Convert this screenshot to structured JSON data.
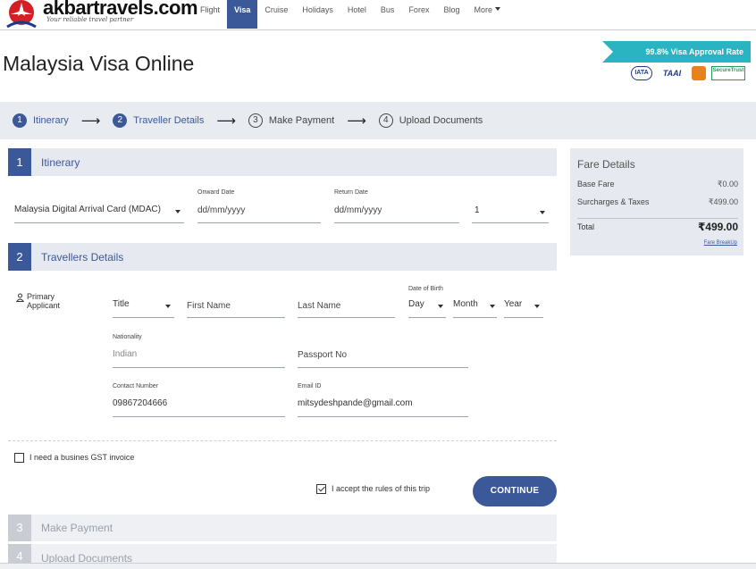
{
  "header": {
    "logo_text": "akbartravels",
    "logo_suffix": ".com",
    "tagline": "Your reliable travel partner",
    "nav": [
      "Flight",
      "Visa",
      "Cruise",
      "Holidays",
      "Hotel",
      "Bus",
      "Forex",
      "Blog",
      "More"
    ],
    "active_nav": "Visa"
  },
  "page_title": "Malaysia Visa Online",
  "approval_rate": "99.8% Visa Approval Rate",
  "badges": [
    "IATA",
    "TAAI",
    "SecureTrust"
  ],
  "stepper": [
    {
      "num": "1",
      "label": "Itinerary"
    },
    {
      "num": "2",
      "label": "Traveller Details"
    },
    {
      "num": "3",
      "label": "Make Payment"
    },
    {
      "num": "4",
      "label": "Upload Documents"
    }
  ],
  "itinerary": {
    "num": "1",
    "title": "Itinerary",
    "visa_type": "Malaysia Digital Arrival Card (MDAC)",
    "onward_label": "Onward Date",
    "onward_value": "dd/mm/yyyy",
    "return_label": "Return Date",
    "return_value": "dd/mm/yyyy",
    "travellers_count": "1"
  },
  "travellers": {
    "num": "2",
    "title": "Travellers Details",
    "applicant_label_1": "Primary",
    "applicant_label_2": "Applicant",
    "title_field": "Title",
    "first_name": "First Name",
    "last_name": "Last Name",
    "dob_label": "Date of Birth",
    "day": "Day",
    "month": "Month",
    "year": "Year",
    "nationality_label": "Nationality",
    "nationality_value": "Indian",
    "passport": "Passport No",
    "contact_label": "Contact Number",
    "contact_value": "09867204666",
    "email_label": "Email ID",
    "email_value": "mitsydeshpande@gmail.com"
  },
  "gst_label": "I need a busines GST invoice",
  "accept_label": "I accept the rules of this trip",
  "continue_label": "CONTINUE",
  "payment_section": {
    "num": "3",
    "title": "Make Payment"
  },
  "upload_section": {
    "num": "4",
    "title": "Upload Documents"
  },
  "fare": {
    "title": "Fare Details",
    "base_label": "Base Fare",
    "base_value": "₹0.00",
    "sur_label": "Surcharges & Taxes",
    "sur_value": "₹499.00",
    "total_label": "Total",
    "total_value": "₹499.00",
    "breakup_link": "Fare BreakUp"
  },
  "colors": {
    "brand": "#3b5998",
    "accent": "#2ab3c0",
    "logo_red": "#d32027"
  }
}
